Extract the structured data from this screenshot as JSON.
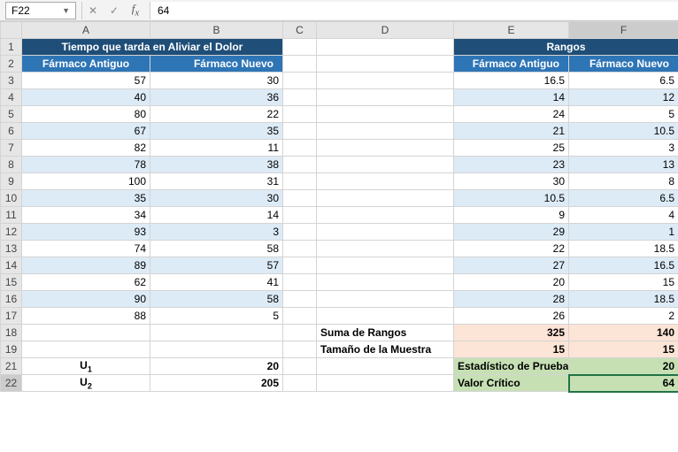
{
  "namebox": "F22",
  "formula_value": "64",
  "cols": [
    "A",
    "B",
    "C",
    "D",
    "E",
    "F"
  ],
  "titles": {
    "left": "Tiempo que tarda en Aliviar el Dolor",
    "right": "Rangos"
  },
  "headers": {
    "antiguo": "Fármaco Antiguo",
    "nuevo": "Fármaco Nuevo"
  },
  "left_rows": [
    {
      "a": "57",
      "b": "30"
    },
    {
      "a": "40",
      "b": "36"
    },
    {
      "a": "80",
      "b": "22"
    },
    {
      "a": "67",
      "b": "35"
    },
    {
      "a": "82",
      "b": "11"
    },
    {
      "a": "78",
      "b": "38"
    },
    {
      "a": "100",
      "b": "31"
    },
    {
      "a": "35",
      "b": "30"
    },
    {
      "a": "34",
      "b": "14"
    },
    {
      "a": "93",
      "b": "3"
    },
    {
      "a": "74",
      "b": "58"
    },
    {
      "a": "89",
      "b": "57"
    },
    {
      "a": "62",
      "b": "41"
    },
    {
      "a": "90",
      "b": "58"
    },
    {
      "a": "88",
      "b": "5"
    }
  ],
  "right_rows": [
    {
      "e": "16.5",
      "f": "6.5"
    },
    {
      "e": "14",
      "f": "12"
    },
    {
      "e": "24",
      "f": "5"
    },
    {
      "e": "21",
      "f": "10.5"
    },
    {
      "e": "25",
      "f": "3"
    },
    {
      "e": "23",
      "f": "13"
    },
    {
      "e": "30",
      "f": "8"
    },
    {
      "e": "10.5",
      "f": "6.5"
    },
    {
      "e": "9",
      "f": "4"
    },
    {
      "e": "29",
      "f": "1"
    },
    {
      "e": "22",
      "f": "18.5"
    },
    {
      "e": "27",
      "f": "16.5"
    },
    {
      "e": "20",
      "f": "15"
    },
    {
      "e": "28",
      "f": "18.5"
    },
    {
      "e": "26",
      "f": "2"
    }
  ],
  "suma_label": "Suma de Rangos",
  "suma": {
    "e": "325",
    "f": "140"
  },
  "tam_label": "Tamaño de la Muestra",
  "tam": {
    "e": "15",
    "f": "15"
  },
  "u1_label_prefix": "U",
  "u1_sub": "1",
  "u1_val": "20",
  "u2_sub": "2",
  "u2_val": "205",
  "stat_label": "Estadístico de Prueba",
  "stat_val": "20",
  "crit_label": "Valor Crítico",
  "crit_val": "64"
}
